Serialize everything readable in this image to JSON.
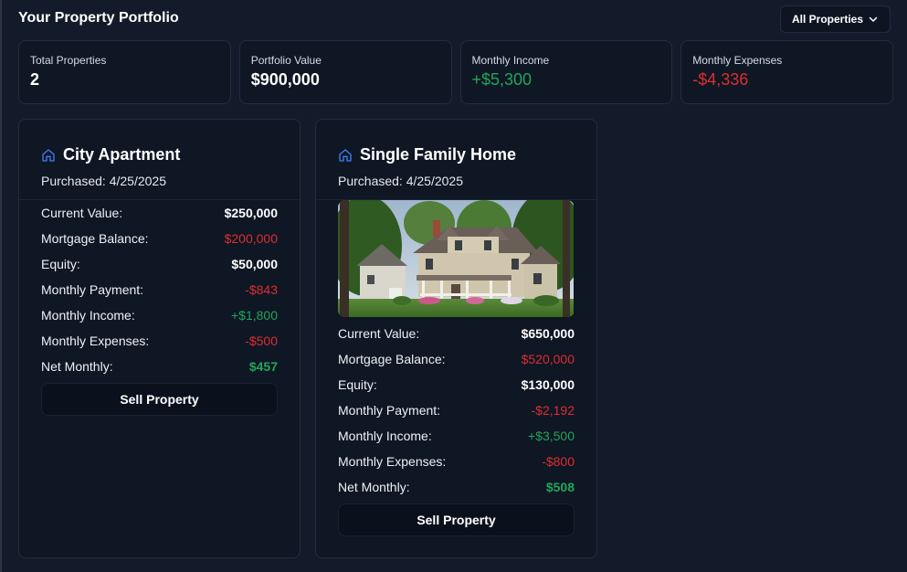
{
  "header": {
    "title": "Your Property Portfolio",
    "filter_label": "All Properties"
  },
  "stats": [
    {
      "label": "Total Properties",
      "value": "2"
    },
    {
      "label": "Portfolio Value",
      "value": "$900,000"
    },
    {
      "label": "Monthly Income",
      "value": "+$5,300"
    },
    {
      "label": "Monthly Expenses",
      "value": "-$4,336"
    }
  ],
  "properties": [
    {
      "name": "City Apartment",
      "purchased": "Purchased: 4/25/2025",
      "rows": [
        {
          "label": "Current Value:",
          "value": "$250,000"
        },
        {
          "label": "Mortgage Balance:",
          "value": "$200,000"
        },
        {
          "label": "Equity:",
          "value": "$50,000"
        },
        {
          "label": "Monthly Payment:",
          "value": "-$843"
        },
        {
          "label": "Monthly Income:",
          "value": "+$1,800"
        },
        {
          "label": "Monthly Expenses:",
          "value": "-$500"
        },
        {
          "label": "Net Monthly:",
          "value": "$457"
        }
      ],
      "sell_label": "Sell Property"
    },
    {
      "name": "Single Family Home",
      "purchased": "Purchased: 4/25/2025",
      "rows": [
        {
          "label": "Current Value:",
          "value": "$650,000"
        },
        {
          "label": "Mortgage Balance:",
          "value": "$520,000"
        },
        {
          "label": "Equity:",
          "value": "$130,000"
        },
        {
          "label": "Monthly Payment:",
          "value": "-$2,192"
        },
        {
          "label": "Monthly Income:",
          "value": "+$3,500"
        },
        {
          "label": "Monthly Expenses:",
          "value": "-$800"
        },
        {
          "label": "Net Monthly:",
          "value": "$508"
        }
      ],
      "sell_label": "Sell Property"
    }
  ],
  "colors": {
    "background": "#131b2a",
    "card": "#0f1624",
    "positive": "#22a55a",
    "negative": "#dc2f2f",
    "icon_accent": "#3b82f6"
  },
  "icons": {
    "filter": "chevron-down-icon",
    "property": "home-icon"
  }
}
